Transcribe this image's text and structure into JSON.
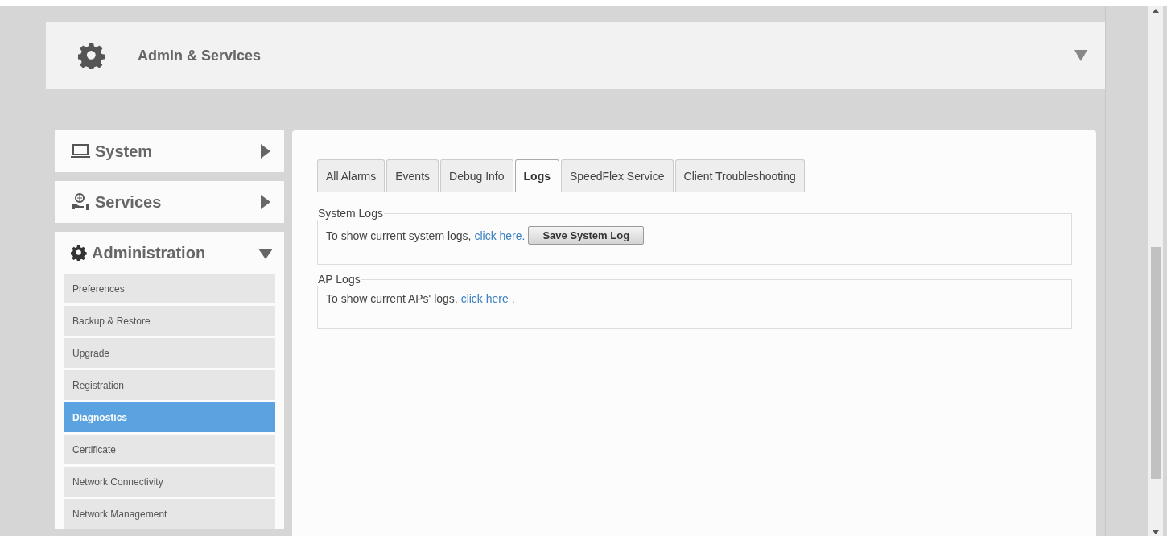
{
  "header": {
    "title": "Admin & Services",
    "expanded": false
  },
  "sidebar": {
    "sections": [
      {
        "label": "System",
        "expanded": false
      },
      {
        "label": "Services",
        "expanded": false
      },
      {
        "label": "Administration",
        "expanded": true,
        "items": [
          {
            "label": "Preferences",
            "selected": false
          },
          {
            "label": "Backup & Restore",
            "selected": false
          },
          {
            "label": "Upgrade",
            "selected": false
          },
          {
            "label": "Registration",
            "selected": false
          },
          {
            "label": "Diagnostics",
            "selected": true
          },
          {
            "label": "Certificate",
            "selected": false
          },
          {
            "label": "Network Connectivity",
            "selected": false
          },
          {
            "label": "Network Management",
            "selected": false
          }
        ]
      }
    ]
  },
  "tabs": [
    {
      "label": "All Alarms",
      "selected": false
    },
    {
      "label": "Events",
      "selected": false
    },
    {
      "label": "Debug Info",
      "selected": false
    },
    {
      "label": "Logs",
      "selected": true
    },
    {
      "label": "SpeedFlex Service",
      "selected": false
    },
    {
      "label": "Client Troubleshooting",
      "selected": false
    }
  ],
  "groups": [
    {
      "legend": "System Logs",
      "text": "To show current system logs, ",
      "link": "click here.",
      "button": "Save System Log"
    },
    {
      "legend": "AP Logs",
      "text": "To show current APs' logs, ",
      "link": "click here",
      "suffix": " ."
    }
  ]
}
